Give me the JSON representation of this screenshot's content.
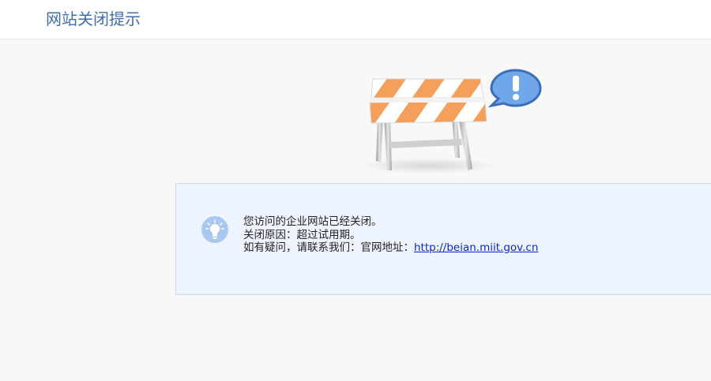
{
  "header": {
    "title": "网站关闭提示"
  },
  "illustration": {
    "icon": "barrier-icon",
    "alert_icon": "exclamation-bubble-icon",
    "colors": {
      "stripe_orange": "#f5a05a",
      "stripe_white": "#ffffff",
      "leg_gray": "#c8c8c8",
      "bubble_blue": "#6fa7ea",
      "bubble_border": "#3c6fb8"
    }
  },
  "notice": {
    "icon": "lightbulb-icon",
    "line1": "您访问的企业网站已经关闭。",
    "line2": "关闭原因：超过试用期。",
    "line3_prefix": "如有疑问，请联系我们：官网地址：",
    "link_text": "http://beian.miit.gov.cn",
    "colors": {
      "background": "#eef4fd",
      "border": "#c9d9ef",
      "link": "#0b28c9",
      "badge": "#a9c8ef"
    }
  },
  "colors": {
    "accent_title": "#3f6ea8",
    "page_background": "#f8f8f8"
  }
}
